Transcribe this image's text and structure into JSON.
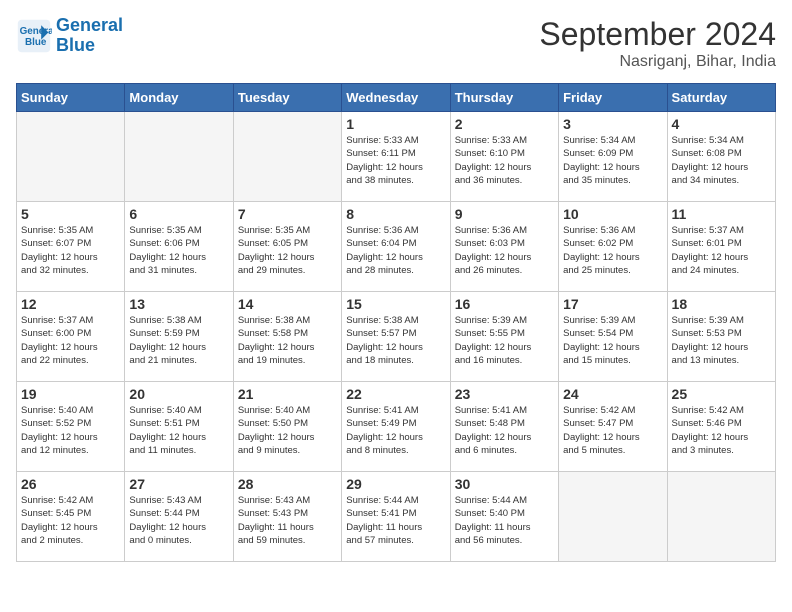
{
  "header": {
    "logo_line1": "General",
    "logo_line2": "Blue",
    "month": "September 2024",
    "location": "Nasriganj, Bihar, India"
  },
  "weekdays": [
    "Sunday",
    "Monday",
    "Tuesday",
    "Wednesday",
    "Thursday",
    "Friday",
    "Saturday"
  ],
  "days": [
    {
      "num": "",
      "info": ""
    },
    {
      "num": "",
      "info": ""
    },
    {
      "num": "",
      "info": ""
    },
    {
      "num": "1",
      "info": "Sunrise: 5:33 AM\nSunset: 6:11 PM\nDaylight: 12 hours\nand 38 minutes."
    },
    {
      "num": "2",
      "info": "Sunrise: 5:33 AM\nSunset: 6:10 PM\nDaylight: 12 hours\nand 36 minutes."
    },
    {
      "num": "3",
      "info": "Sunrise: 5:34 AM\nSunset: 6:09 PM\nDaylight: 12 hours\nand 35 minutes."
    },
    {
      "num": "4",
      "info": "Sunrise: 5:34 AM\nSunset: 6:08 PM\nDaylight: 12 hours\nand 34 minutes."
    },
    {
      "num": "5",
      "info": "Sunrise: 5:35 AM\nSunset: 6:07 PM\nDaylight: 12 hours\nand 32 minutes."
    },
    {
      "num": "6",
      "info": "Sunrise: 5:35 AM\nSunset: 6:06 PM\nDaylight: 12 hours\nand 31 minutes."
    },
    {
      "num": "7",
      "info": "Sunrise: 5:35 AM\nSunset: 6:05 PM\nDaylight: 12 hours\nand 29 minutes."
    },
    {
      "num": "8",
      "info": "Sunrise: 5:36 AM\nSunset: 6:04 PM\nDaylight: 12 hours\nand 28 minutes."
    },
    {
      "num": "9",
      "info": "Sunrise: 5:36 AM\nSunset: 6:03 PM\nDaylight: 12 hours\nand 26 minutes."
    },
    {
      "num": "10",
      "info": "Sunrise: 5:36 AM\nSunset: 6:02 PM\nDaylight: 12 hours\nand 25 minutes."
    },
    {
      "num": "11",
      "info": "Sunrise: 5:37 AM\nSunset: 6:01 PM\nDaylight: 12 hours\nand 24 minutes."
    },
    {
      "num": "12",
      "info": "Sunrise: 5:37 AM\nSunset: 6:00 PM\nDaylight: 12 hours\nand 22 minutes."
    },
    {
      "num": "13",
      "info": "Sunrise: 5:38 AM\nSunset: 5:59 PM\nDaylight: 12 hours\nand 21 minutes."
    },
    {
      "num": "14",
      "info": "Sunrise: 5:38 AM\nSunset: 5:58 PM\nDaylight: 12 hours\nand 19 minutes."
    },
    {
      "num": "15",
      "info": "Sunrise: 5:38 AM\nSunset: 5:57 PM\nDaylight: 12 hours\nand 18 minutes."
    },
    {
      "num": "16",
      "info": "Sunrise: 5:39 AM\nSunset: 5:55 PM\nDaylight: 12 hours\nand 16 minutes."
    },
    {
      "num": "17",
      "info": "Sunrise: 5:39 AM\nSunset: 5:54 PM\nDaylight: 12 hours\nand 15 minutes."
    },
    {
      "num": "18",
      "info": "Sunrise: 5:39 AM\nSunset: 5:53 PM\nDaylight: 12 hours\nand 13 minutes."
    },
    {
      "num": "19",
      "info": "Sunrise: 5:40 AM\nSunset: 5:52 PM\nDaylight: 12 hours\nand 12 minutes."
    },
    {
      "num": "20",
      "info": "Sunrise: 5:40 AM\nSunset: 5:51 PM\nDaylight: 12 hours\nand 11 minutes."
    },
    {
      "num": "21",
      "info": "Sunrise: 5:40 AM\nSunset: 5:50 PM\nDaylight: 12 hours\nand 9 minutes."
    },
    {
      "num": "22",
      "info": "Sunrise: 5:41 AM\nSunset: 5:49 PM\nDaylight: 12 hours\nand 8 minutes."
    },
    {
      "num": "23",
      "info": "Sunrise: 5:41 AM\nSunset: 5:48 PM\nDaylight: 12 hours\nand 6 minutes."
    },
    {
      "num": "24",
      "info": "Sunrise: 5:42 AM\nSunset: 5:47 PM\nDaylight: 12 hours\nand 5 minutes."
    },
    {
      "num": "25",
      "info": "Sunrise: 5:42 AM\nSunset: 5:46 PM\nDaylight: 12 hours\nand 3 minutes."
    },
    {
      "num": "26",
      "info": "Sunrise: 5:42 AM\nSunset: 5:45 PM\nDaylight: 12 hours\nand 2 minutes."
    },
    {
      "num": "27",
      "info": "Sunrise: 5:43 AM\nSunset: 5:44 PM\nDaylight: 12 hours\nand 0 minutes."
    },
    {
      "num": "28",
      "info": "Sunrise: 5:43 AM\nSunset: 5:43 PM\nDaylight: 11 hours\nand 59 minutes."
    },
    {
      "num": "29",
      "info": "Sunrise: 5:44 AM\nSunset: 5:41 PM\nDaylight: 11 hours\nand 57 minutes."
    },
    {
      "num": "30",
      "info": "Sunrise: 5:44 AM\nSunset: 5:40 PM\nDaylight: 11 hours\nand 56 minutes."
    },
    {
      "num": "",
      "info": ""
    },
    {
      "num": "",
      "info": ""
    },
    {
      "num": "",
      "info": ""
    },
    {
      "num": "",
      "info": ""
    },
    {
      "num": "",
      "info": ""
    }
  ]
}
